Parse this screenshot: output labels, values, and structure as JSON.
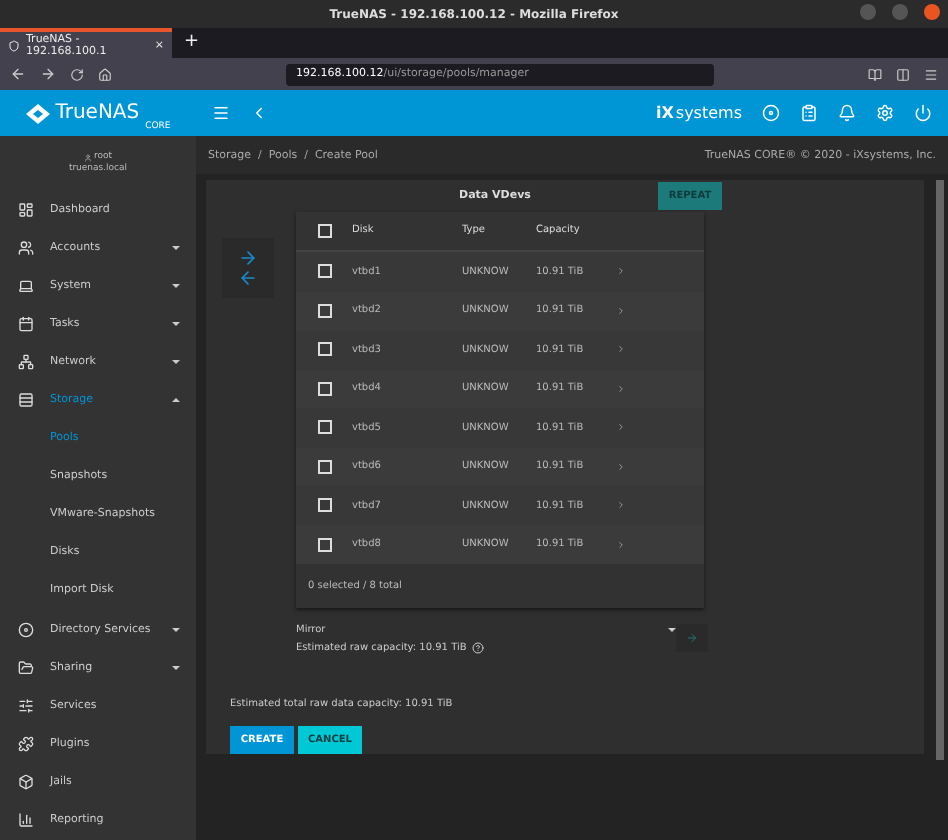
{
  "window": {
    "title": "TrueNAS - 192.168.100.12 - Mozilla Firefox"
  },
  "tabs": [
    {
      "label": "TrueNAS - 192.168.100.1",
      "selected": true,
      "close": "×"
    }
  ],
  "new_tab": "+",
  "address_bar": {
    "host": "192.168.100.12",
    "path": "/ui/storage/pools/manager"
  },
  "app_header": {
    "logo": "TrueNAS",
    "logo_sub": "CORE",
    "vendor_mark": "iX",
    "vendor": "systems"
  },
  "user": {
    "name": "root",
    "host": "truenas.local"
  },
  "sidebar": {
    "items": [
      {
        "label": "Dashboard",
        "kind": "item",
        "selected": false
      },
      {
        "label": "Accounts",
        "kind": "group",
        "expanded": false,
        "selected": false
      },
      {
        "label": "System",
        "kind": "group",
        "expanded": false,
        "selected": false
      },
      {
        "label": "Tasks",
        "kind": "group",
        "expanded": false,
        "selected": false
      },
      {
        "label": "Network",
        "kind": "group",
        "expanded": false,
        "selected": false
      },
      {
        "label": "Storage",
        "kind": "group",
        "expanded": true,
        "selected": true
      },
      {
        "label": "Pools",
        "kind": "subitem",
        "selected": true
      },
      {
        "label": "Snapshots",
        "kind": "subitem",
        "selected": false
      },
      {
        "label": "VMware-Snapshots",
        "kind": "subitem",
        "selected": false
      },
      {
        "label": "Disks",
        "kind": "subitem",
        "selected": false
      },
      {
        "label": "Import Disk",
        "kind": "subitem",
        "selected": false
      },
      {
        "label": "Directory Services",
        "kind": "group",
        "expanded": false,
        "selected": false
      },
      {
        "label": "Sharing",
        "kind": "group",
        "expanded": false,
        "selected": false
      },
      {
        "label": "Services",
        "kind": "item",
        "selected": false
      },
      {
        "label": "Plugins",
        "kind": "item",
        "selected": false
      },
      {
        "label": "Jails",
        "kind": "item",
        "selected": false
      },
      {
        "label": "Reporting",
        "kind": "item",
        "selected": false
      }
    ]
  },
  "breadcrumb": "Storage  /  Pools  /  Create Pool",
  "copyright": "TrueNAS CORE® © 2020 - iXsystems, Inc.",
  "vdev": {
    "title": "Data VDevs",
    "repeat_button": "REPEAT",
    "table": {
      "columns": [
        "Disk",
        "Type",
        "Capacity"
      ],
      "header_checked": false,
      "rows": [
        {
          "disk": "vtbd1",
          "type": "UNKNOW",
          "capacity": "10.91 TiB",
          "checked": false
        },
        {
          "disk": "vtbd2",
          "type": "UNKNOW",
          "capacity": "10.91 TiB",
          "checked": false
        },
        {
          "disk": "vtbd3",
          "type": "UNKNOW",
          "capacity": "10.91 TiB",
          "checked": false
        },
        {
          "disk": "vtbd4",
          "type": "UNKNOW",
          "capacity": "10.91 TiB",
          "checked": false
        },
        {
          "disk": "vtbd5",
          "type": "UNKNOW",
          "capacity": "10.91 TiB",
          "checked": false
        },
        {
          "disk": "vtbd6",
          "type": "UNKNOW",
          "capacity": "10.91 TiB",
          "checked": false
        },
        {
          "disk": "vtbd7",
          "type": "UNKNOW",
          "capacity": "10.91 TiB",
          "checked": false
        },
        {
          "disk": "vtbd8",
          "type": "UNKNOW",
          "capacity": "10.91 TiB",
          "checked": false
        }
      ],
      "footer": "0 selected / 8 total"
    },
    "layout": "Mirror",
    "raw_capacity": "Estimated raw capacity: 10.91 TiB"
  },
  "total_capacity": "Estimated total raw data capacity: 10.91 TiB",
  "buttons": [
    {
      "label": "CREATE",
      "kind": "primary"
    },
    {
      "label": "CANCEL",
      "kind": "secondary"
    }
  ]
}
